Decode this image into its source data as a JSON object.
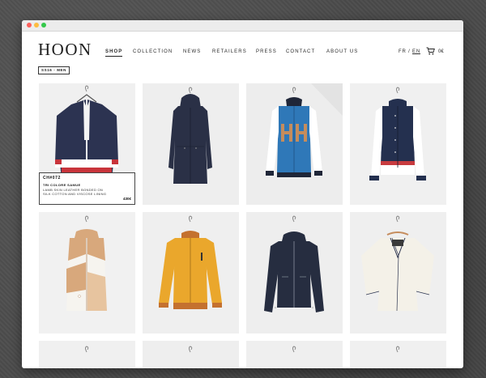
{
  "brand": {
    "logo": "HOON"
  },
  "nav": {
    "items": [
      {
        "label": "SHOP",
        "active": true
      },
      {
        "label": "COLLECTION",
        "active": false
      },
      {
        "label": "NEWS",
        "active": false
      },
      {
        "label": "RETAILERS",
        "active": false
      },
      {
        "label": "PRESS",
        "active": false
      },
      {
        "label": "CONTACT",
        "active": false
      },
      {
        "label": "ABOUT US",
        "active": false
      }
    ]
  },
  "header_right": {
    "lang_fr": "FR",
    "lang_sep": "/",
    "lang_en": "EN",
    "cart_icon": "shopping-cart-icon",
    "cart_total": "0€"
  },
  "filter": {
    "season_label": "SS16 - MEN"
  },
  "featured": {
    "code": "CH#072",
    "name": "TRI COLORE SAMUE",
    "description": "LAMB SKIN LEATHER BONDED ON SILK COTTON AND VISCOSE LINING",
    "price": "430€"
  },
  "products": [
    {
      "kind": "navy-red-jacket",
      "colors": [
        "#2b3350",
        "#ffffff",
        "#c8343b"
      ]
    },
    {
      "kind": "navy-parka",
      "colors": [
        "#2a3046"
      ]
    },
    {
      "kind": "blue-varsity-hh",
      "colors": [
        "#2f78b8",
        "#ffffff",
        "#c58c5c"
      ]
    },
    {
      "kind": "navy-red-varsity",
      "colors": [
        "#24304f",
        "#ffffff",
        "#c73b3f"
      ]
    },
    {
      "kind": "tan-white-vest",
      "colors": [
        "#d8a87c",
        "#ffffff"
      ]
    },
    {
      "kind": "yellow-bomber",
      "colors": [
        "#eaa72c",
        "#c4712f"
      ]
    },
    {
      "kind": "navy-leather-jacket",
      "colors": [
        "#262d40"
      ]
    },
    {
      "kind": "white-kimono-jacket",
      "colors": [
        "#f4f1e8",
        "#2d3550"
      ]
    }
  ]
}
